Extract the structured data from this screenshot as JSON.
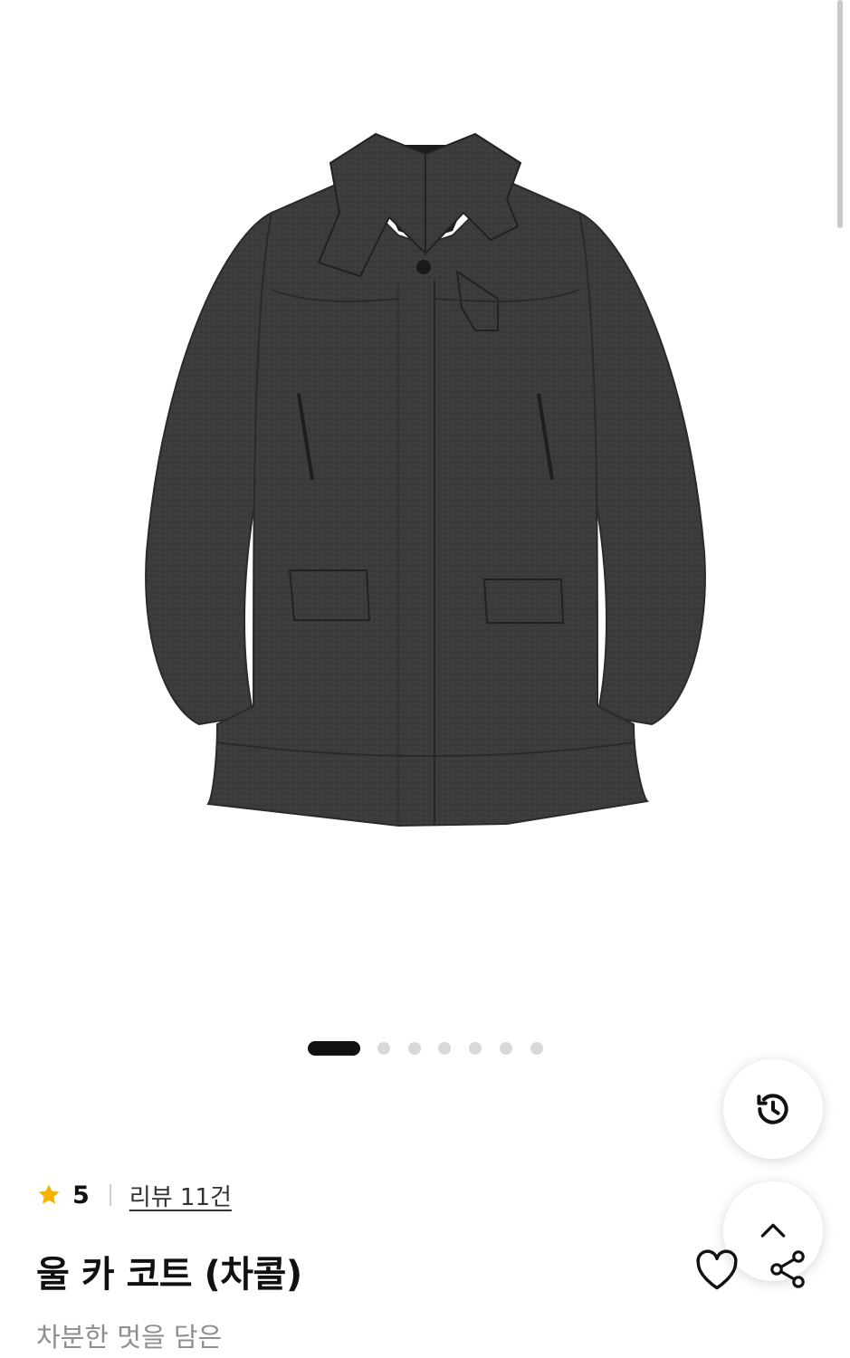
{
  "gallery": {
    "image_icon": "wool-car-coat-image",
    "slide_count": 7,
    "active_slide": 1
  },
  "floating": {
    "history_icon": "history-icon",
    "top_icon": "chevron-up-icon"
  },
  "product": {
    "rating": "5",
    "review_link": "리뷰 11건",
    "title": "울 카 코트 (차콜)",
    "subtitle": "차분한 멋을 담은"
  },
  "actions": {
    "wish_icon": "heart-icon",
    "share_icon": "share-icon"
  },
  "colors": {
    "star": "#F5B301",
    "active_dot": "#111111",
    "inactive_dot": "#D9D9D9",
    "coat": "#3a3a3a"
  }
}
